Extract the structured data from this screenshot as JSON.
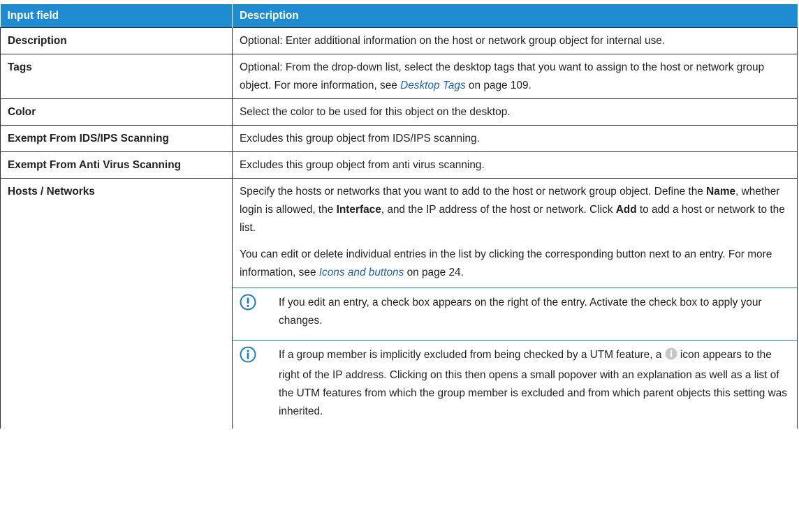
{
  "table": {
    "headers": [
      "Input field",
      "Description"
    ],
    "rows": [
      {
        "name": "Description",
        "text": "Optional: Enter additional information on the host or network group object for internal use."
      },
      {
        "name": "Tags",
        "pre": "Optional: From the drop-down list, select the desktop tags that you want to assign to the host or network group object. For more information, see ",
        "link": "Desktop Tags",
        "post": " on page 109."
      },
      {
        "name": "Color",
        "text": "Select the color to be used for this object on the desktop."
      },
      {
        "name": "Exempt From IDS/IPS Scanning",
        "text": "Excludes this group object from IDS/IPS scanning."
      },
      {
        "name": "Exempt From Anti Virus Scanning",
        "text": "Excludes this group object from anti virus scanning."
      },
      {
        "name": "Hosts / Networks",
        "p1": {
          "a": "Specify the hosts or networks that you want to add to the host or network group object. Define the ",
          "b1": "Name",
          "c": ", whether login is allowed, the ",
          "b2": "Interface",
          "d": ", and the IP address of the host or network. Click ",
          "b3": "Add",
          "e": " to add a host or network to the list."
        },
        "p2": {
          "pre": "You can edit or delete individual entries in the list by clicking the corresponding button next to an entry. For more information, see ",
          "link": "Icons and buttons",
          "post": " on page 24."
        },
        "note_warning": {
          "icon": "exclamation-circle-icon",
          "text": "If you edit an entry, a check box appears on the right of the entry. Activate the check box to apply your changes."
        },
        "note_info": {
          "icon": "info-circle-icon",
          "pre": "If a group member is implicitly excluded from being checked by a UTM feature, a ",
          "inline_icon": "info-filled-icon",
          "post": " icon appears to the right of the IP address. Clicking on this then opens a small popover with an explanation as well as a list of the UTM features from which the group member is excluded and from which parent objects this setting was inherited."
        }
      }
    ]
  },
  "colors": {
    "header_bg": "#1f8bd0",
    "link": "#1c62b8",
    "icon": "#1a7fc1"
  }
}
